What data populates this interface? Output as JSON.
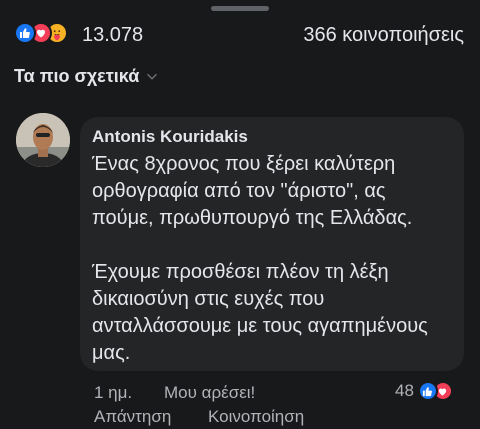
{
  "post": {
    "reaction_count": "13.078",
    "shares": "366 κοινοποιήσεις",
    "reactions": [
      "like-icon",
      "love-icon",
      "care-icon"
    ]
  },
  "sort": {
    "label": "Τα πιο σχετικά"
  },
  "comment": {
    "author": "Antonis Kouridakis",
    "paragraph_1": "Ένας 8χρονος που ξέρει καλύτερη ορθογραφία από τον \"άριστο\", ας πούμε, πρωθυπουργό της Ελλάδας.",
    "paragraph_2": "Έχουμε προσθέσει πλέον τη λέξη δικαιοσύνη στις ευχές που ανταλλάσσουμε με τους αγαπημένους μας.",
    "time": "1 ημ.",
    "like_label": "Μου αρέσει!",
    "reply_label": "Απάντηση",
    "share_label": "Κοινοποίηση",
    "reaction_count": "48",
    "reactions": [
      "like-icon",
      "love-icon"
    ]
  },
  "colors": {
    "background": "#18191a",
    "bubble": "#242526",
    "like": "#1877f2",
    "love": "#f33e58",
    "care": "#f7b125"
  }
}
